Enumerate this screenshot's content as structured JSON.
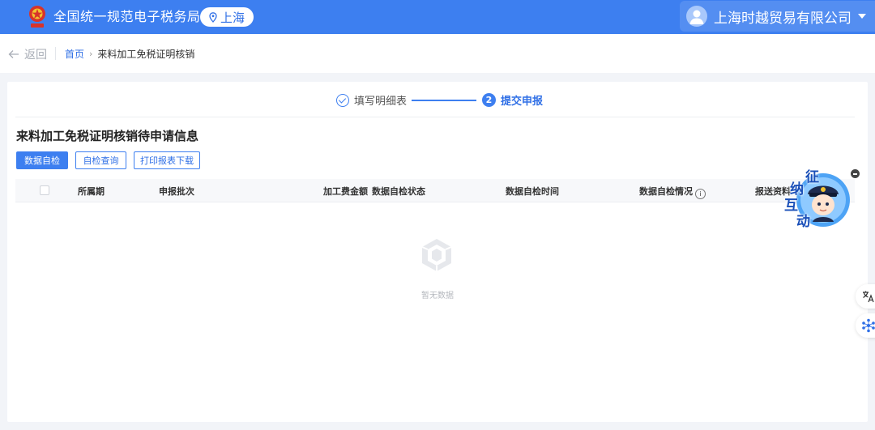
{
  "header": {
    "title": "全国统一规范电子税务局",
    "location": "上海",
    "company": "上海时越贸易有限公司"
  },
  "breadcrumb": {
    "back_label": "返回",
    "home": "首页",
    "current": "来料加工免税证明核销"
  },
  "steps": [
    {
      "label": "填写明细表",
      "status": "done"
    },
    {
      "number": "2",
      "label": "提交申报",
      "status": "active"
    }
  ],
  "section": {
    "title": "来料加工免税证明核销待申请信息"
  },
  "buttons": {
    "self_check": "数据自检",
    "self_check_query": "自检查询",
    "print_download": "打印报表下载"
  },
  "table": {
    "columns": [
      "所属期",
      "申报批次",
      "加工费金额",
      "数据自检状态",
      "数据自检时间",
      "数据自检情况",
      "报送资料"
    ],
    "rows": []
  },
  "empty_text": "暂无数据",
  "mascot": {
    "chars": [
      "征",
      "纳",
      "互",
      "动"
    ]
  },
  "colors": {
    "brand": "#3d7ff0",
    "link": "#2f6fe6"
  },
  "icons": [
    "emblem-icon",
    "location-pin-icon",
    "user-avatar-icon",
    "chevron-down-icon",
    "back-arrow-icon",
    "check-circle-icon",
    "info-icon",
    "empty-box-icon",
    "translate-icon",
    "network-dots-icon",
    "close-icon"
  ]
}
